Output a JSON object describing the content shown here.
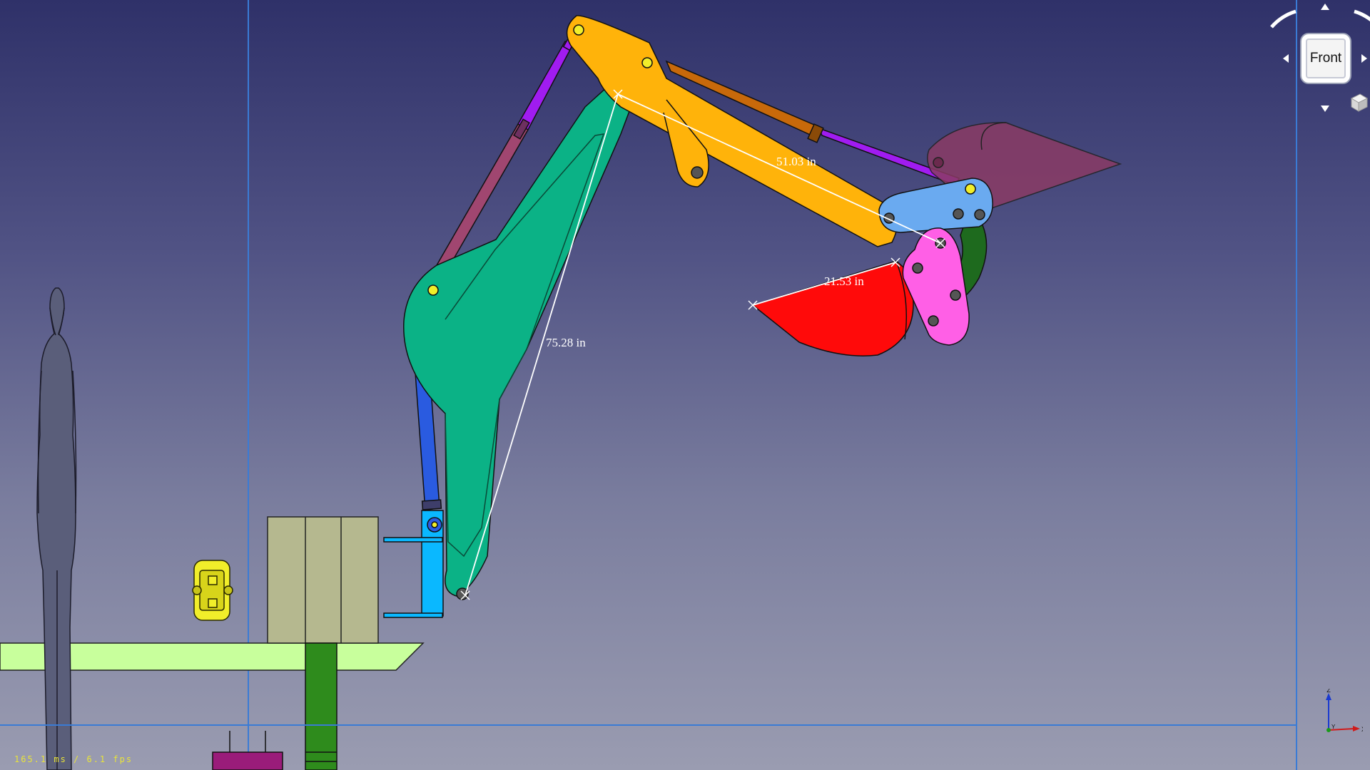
{
  "dimensions": {
    "stick": "51.03 in",
    "boom": "75.28 in",
    "bucket": "21.53 in"
  },
  "status": {
    "frame_time": "165.1 ms / 6.1 fps"
  },
  "navcube": {
    "face_label": "Front"
  },
  "axis": {
    "x": "X",
    "y": "Y",
    "z": "Z"
  },
  "colors": {
    "background_top": "#2f3169",
    "background_bottom": "#9a9cb1",
    "boom": "#0bb286",
    "stick": "#ffb30a",
    "bucket": "#ff0a0a",
    "bucket_link": "#ff5fe6",
    "bucket_preview": "#8a3b65",
    "boom_cylinder": "#2a5be0",
    "stick_cylinder": "#c8690a",
    "bucket_cylinder_rod": "#a01cf0",
    "ground": "#c8ff9c",
    "mount_block": "#b5b88f",
    "mount_bracket": "#0ab8ff",
    "post": "#2e8b1c",
    "guide_lines": "#3a7bd5",
    "fps_text": "#e8e33a"
  }
}
